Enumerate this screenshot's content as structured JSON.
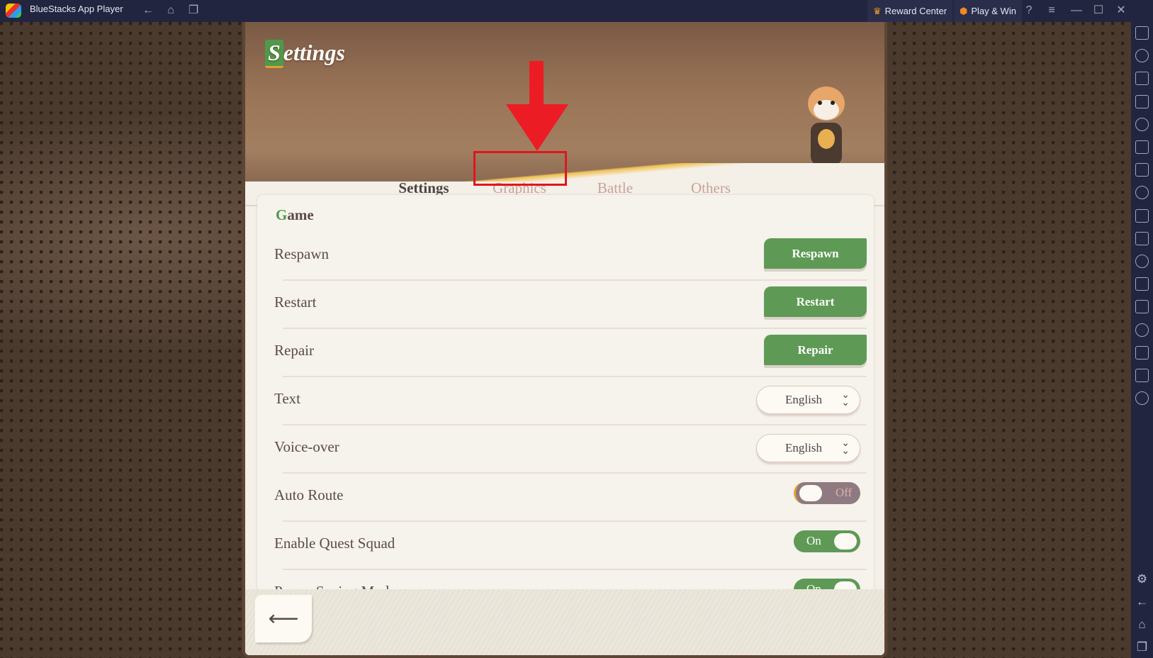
{
  "titlebar": {
    "app_name": "BlueStacks App Player",
    "reward_center": "Reward Center",
    "play_win": "Play & Win"
  },
  "sidebar": {
    "icons": [
      "fullscreen-icon",
      "volume-icon",
      "pointer-icon",
      "keyboard-icon",
      "macro-icon",
      "rotate-sync-icon",
      "bot-icon",
      "apk-install-icon",
      "screenshot-icon",
      "record-icon",
      "media-folder-icon",
      "airplane-icon",
      "multi-instance-icon",
      "shake-icon",
      "location-icon",
      "layers-icon",
      "eco-speed-icon"
    ],
    "bottom_icons": [
      "settings-icon",
      "back-icon",
      "home-icon",
      "recent-apps-icon"
    ]
  },
  "game": {
    "title_first": "S",
    "title_rest": "ettings",
    "tabs": [
      {
        "label": "Settings",
        "active": true
      },
      {
        "label": "Graphics",
        "active": false
      },
      {
        "label": "Battle",
        "active": false
      },
      {
        "label": "Others",
        "active": false
      }
    ],
    "section_first": "G",
    "section_rest": "ame",
    "rows": [
      {
        "label": "Respawn",
        "type": "button",
        "value": "Respawn"
      },
      {
        "label": "Restart",
        "type": "button",
        "value": "Restart"
      },
      {
        "label": "Repair",
        "type": "button",
        "value": "Repair"
      },
      {
        "label": "Text",
        "type": "dropdown",
        "value": "English"
      },
      {
        "label": "Voice-over",
        "type": "dropdown",
        "value": "English"
      },
      {
        "label": "Auto Route",
        "type": "toggle",
        "value": "Off"
      },
      {
        "label": "Enable Quest Squad",
        "type": "toggle",
        "value": "On"
      },
      {
        "label": "Power Saving Mode",
        "type": "toggle",
        "value": "On"
      }
    ]
  },
  "annotation": {
    "color": "#ec1c24",
    "target": "Graphics"
  },
  "colors": {
    "accent_green": "#5e9a55",
    "titlebar": "#22253f"
  }
}
